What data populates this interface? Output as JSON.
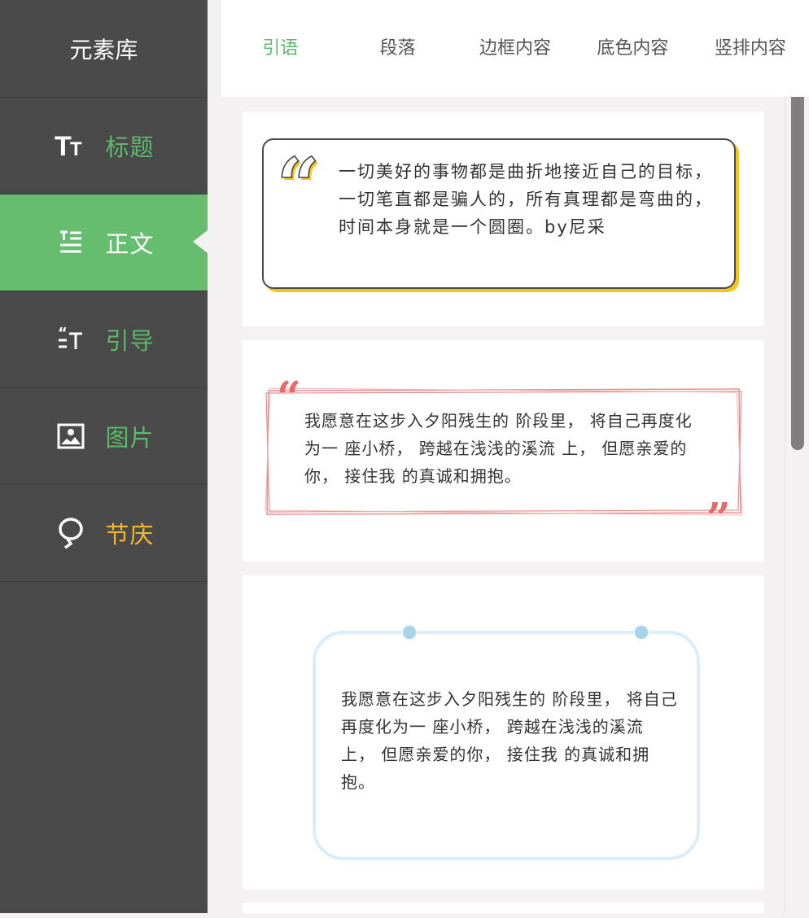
{
  "sidebar": {
    "title": "元素库",
    "items": [
      {
        "label": "标题",
        "icon": "heading-icon"
      },
      {
        "label": "正文",
        "icon": "text-body-icon"
      },
      {
        "label": "引导",
        "icon": "guide-icon"
      },
      {
        "label": "图片",
        "icon": "image-icon"
      },
      {
        "label": "节庆",
        "icon": "festival-icon"
      }
    ],
    "active_index": 1
  },
  "tabs": [
    "引语",
    "段落",
    "边框内容",
    "底色内容",
    "竖排内容"
  ],
  "active_tab": 0,
  "cards": [
    {
      "text": "一切美好的事物都是曲折地接近自己的目标，一切笔直都是骗人的，所有真理都是弯曲的，时间本身就是一个圆圈。by尼采"
    },
    {
      "text": "我愿意在这步入夕阳残生的 阶段里， 将自己再度化为一 座小桥， 跨越在浅浅的溪流 上， 但愿亲爱的你， 接住我 的真诚和拥抱。"
    },
    {
      "text": "我愿意在这步入夕阳残生的 阶段里， 将自己再度化为一 座小桥， 跨越在浅浅的溪流 上， 但愿亲爱的你， 接住我 的真诚和拥抱。"
    }
  ],
  "colors": {
    "accent_green": "#5cb96a",
    "active_bg": "#66bd6f",
    "sidebar_bg": "#4a4a4a",
    "festival_orange": "#f2b632",
    "quote_yellow": "#f5c518",
    "quote_red": "#e56a6a",
    "frame_blue": "#d9eefc"
  }
}
